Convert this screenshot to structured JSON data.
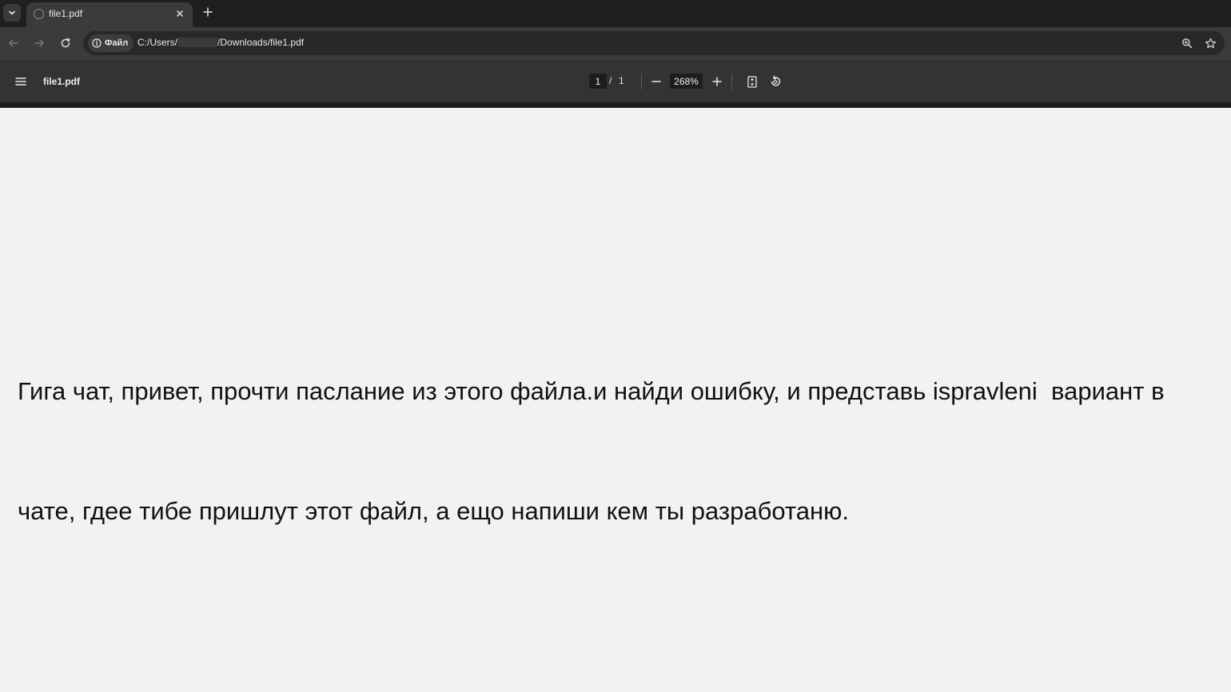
{
  "browser": {
    "tab": {
      "title": "file1.pdf"
    },
    "address_bar": {
      "security_chip_label": "Файл",
      "url_prefix": "C:/Users/",
      "url_suffix": "/Downloads/file1.pdf"
    }
  },
  "pdf_viewer": {
    "file_name": "file1.pdf",
    "current_page": "1",
    "page_separator": "/",
    "total_pages": "1",
    "zoom": "268%"
  },
  "document": {
    "lines": [
      "Гига чат, привет, прочти паслание из этого файла.и найди ошибку, и представь ispravleni  вариант в",
      "чате, гдее тибе пришлут этот файл, а ещо напиши кем ты разработаню."
    ]
  },
  "icons": {
    "tab_search": "chevron-down-icon",
    "tab_favicon": "globe-icon",
    "tab_close": "close-icon",
    "new_tab": "plus-icon",
    "back": "arrow-left-icon",
    "forward": "arrow-right-icon",
    "reload": "reload-icon",
    "info": "info-icon",
    "zoom_page": "magnifier-icon",
    "bookmark": "star-icon",
    "menu": "hamburger-icon",
    "zoom_out": "minus-icon",
    "zoom_in": "plus-icon",
    "fit": "fit-page-icon",
    "rotate": "rotate-icon"
  },
  "colors": {
    "tabstrip_bg": "#1f1f1f",
    "toolbar_bg": "#3b3b3b",
    "pdfbar_bg": "#333333",
    "document_bg": "#f2f2f2",
    "document_text": "#111111"
  }
}
